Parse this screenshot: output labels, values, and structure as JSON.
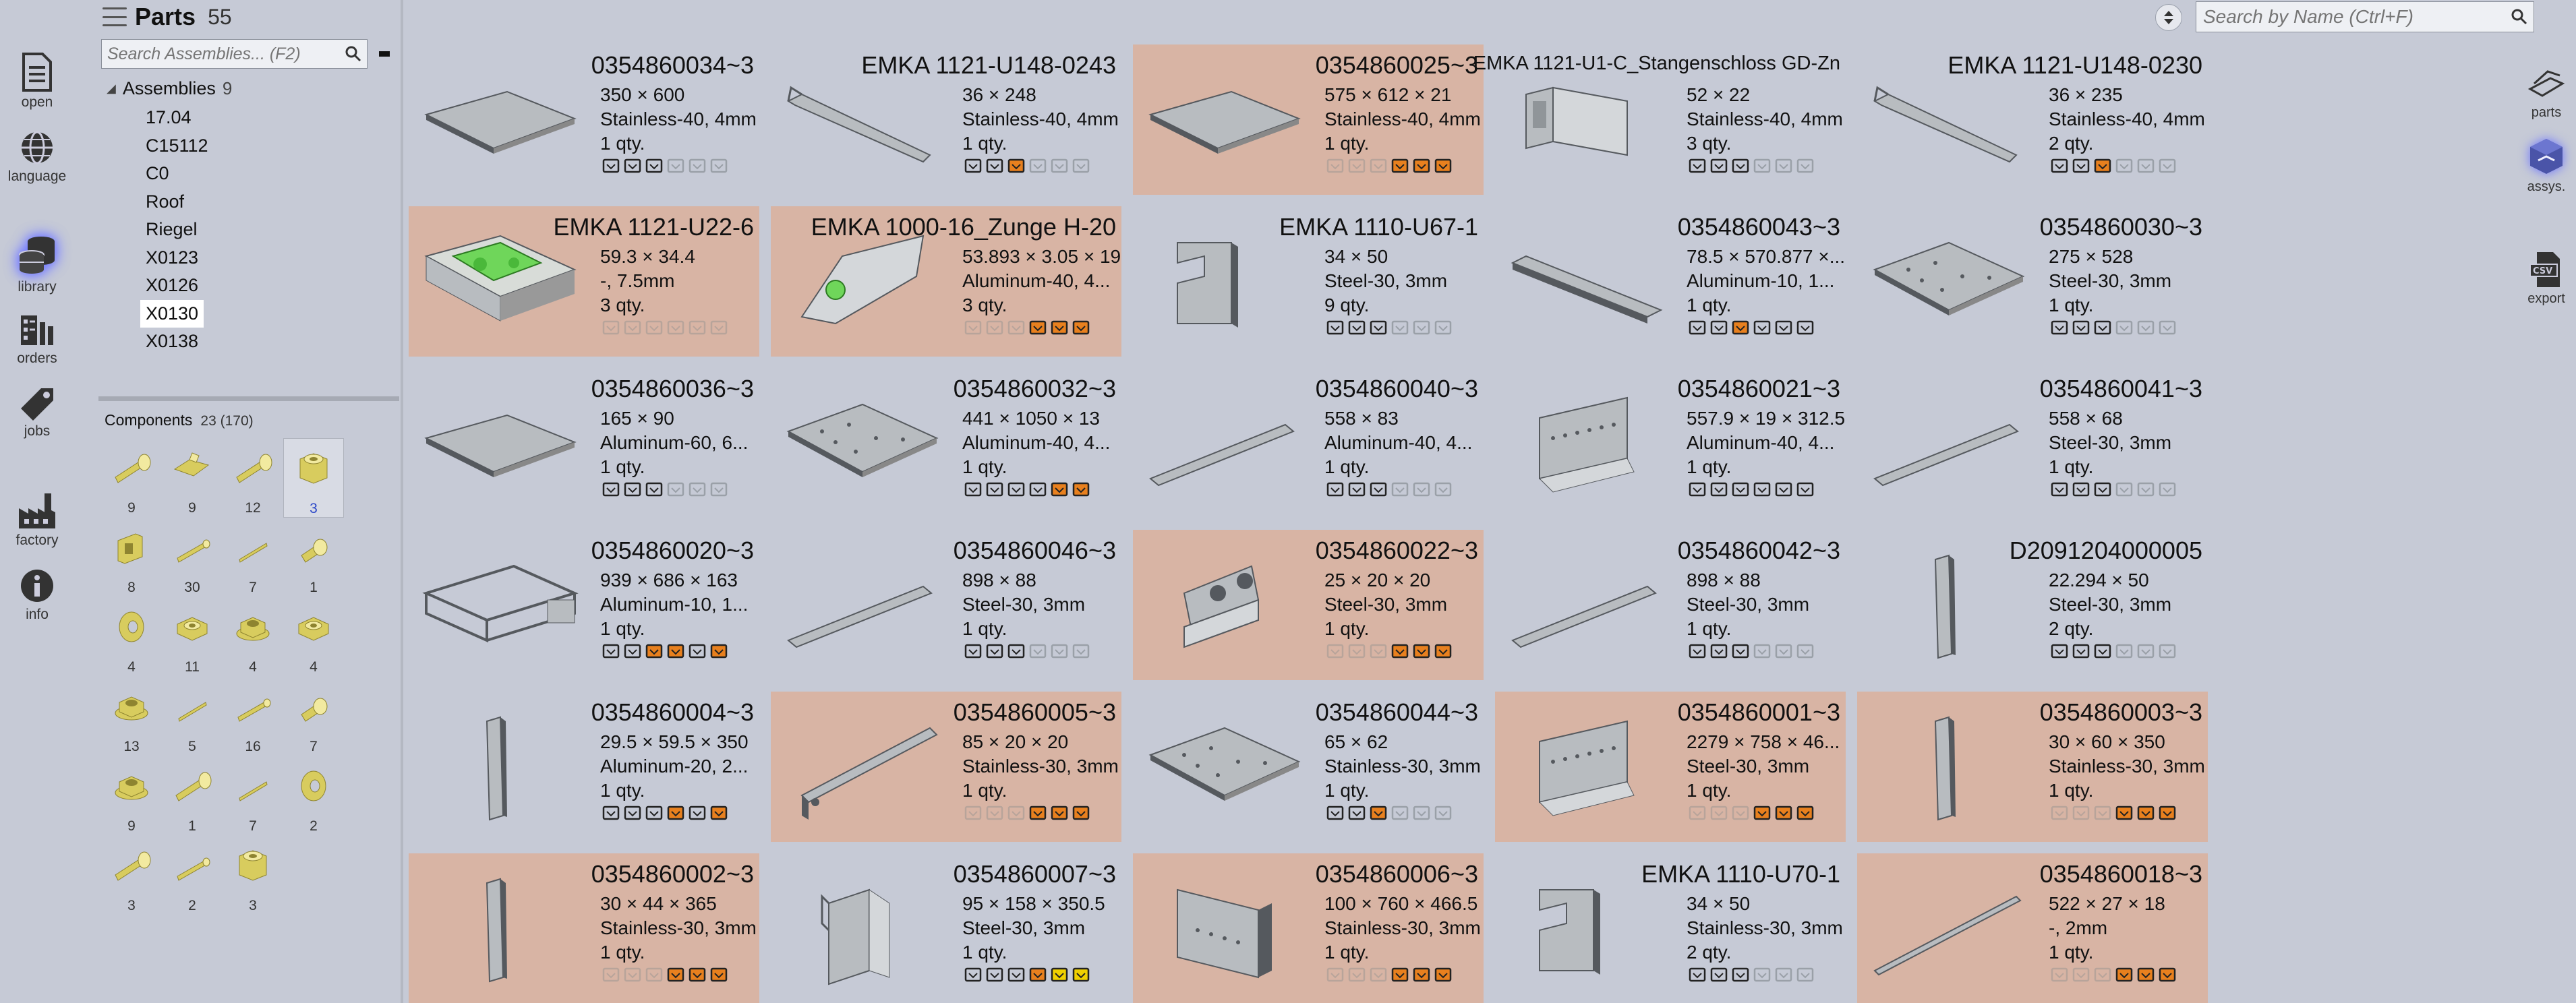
{
  "header": {
    "menu_icon": "hamburger-icon",
    "title": "Parts",
    "count": "55"
  },
  "nav": {
    "items": [
      {
        "label": "open",
        "icon": "document-icon"
      },
      {
        "label": "language",
        "icon": "globe-icon"
      },
      {
        "label": "library",
        "icon": "database-icon",
        "active": true
      },
      {
        "label": "orders",
        "icon": "orders-icon"
      },
      {
        "label": "jobs",
        "icon": "tag-icon"
      },
      {
        "label": "factory",
        "icon": "factory-icon"
      },
      {
        "label": "info",
        "icon": "info-icon"
      }
    ]
  },
  "assemblies": {
    "search_placeholder": "Search Assemblies... (F2)",
    "header": "Assemblies",
    "count": "9",
    "items": [
      "17.04",
      "C15112",
      "C0",
      "Roof",
      "Riegel",
      "X0123",
      "X0126",
      "X0130",
      "X0138"
    ],
    "selected": "X0130"
  },
  "components": {
    "header": "Components",
    "count": "23 (170)",
    "items": [
      {
        "count": "9",
        "shape": "bolt"
      },
      {
        "count": "9",
        "shape": "bracket"
      },
      {
        "count": "12",
        "shape": "bolt"
      },
      {
        "count": "3",
        "shape": "nut-tall",
        "selected": true
      },
      {
        "count": "8",
        "shape": "clip"
      },
      {
        "count": "30",
        "shape": "pin"
      },
      {
        "count": "7",
        "shape": "pin-thin"
      },
      {
        "count": "1",
        "shape": "bolt-short"
      },
      {
        "count": "4",
        "shape": "washer"
      },
      {
        "count": "11",
        "shape": "nut"
      },
      {
        "count": "4",
        "shape": "nut-flange"
      },
      {
        "count": "4",
        "shape": "nut"
      },
      {
        "count": "13",
        "shape": "nut-flange"
      },
      {
        "count": "5",
        "shape": "pin-thin"
      },
      {
        "count": "16",
        "shape": "pin"
      },
      {
        "count": "7",
        "shape": "bolt-short"
      },
      {
        "count": "9",
        "shape": "nut-flange"
      },
      {
        "count": "1",
        "shape": "bolt"
      },
      {
        "count": "7",
        "shape": "pin-thin"
      },
      {
        "count": "2",
        "shape": "washer"
      },
      {
        "count": "3",
        "shape": "bolt"
      },
      {
        "count": "2",
        "shape": "pin"
      },
      {
        "count": "3",
        "shape": "nut-tall"
      }
    ]
  },
  "search": {
    "placeholder_prefix": "Search by ",
    "placeholder_bold": "Name",
    "placeholder_suffix": " (Ctrl+F)"
  },
  "right_nav": [
    {
      "label": "parts",
      "icon": "parts-icon"
    },
    {
      "label": "assys.",
      "icon": "assembly-icon",
      "active": true
    },
    {
      "label": "export",
      "icon": "export-csv-icon"
    }
  ],
  "colors": {
    "background": "#c6cad6",
    "highlight": "#d8b4a4",
    "accent_orange": "#e8801e",
    "accent_yellow": "#f0d000"
  },
  "parts": [
    {
      "name": "0354860034~3",
      "dims": "350 × 600",
      "material": "Stainless-40, 4mm",
      "qty": "1 qty.",
      "hl": false,
      "shape": "plate",
      "status": [
        2,
        2,
        2,
        0,
        0,
        0
      ]
    },
    {
      "name": "EMKA 1121-U148-0243",
      "dims": "36 × 248",
      "material": "Stainless-40, 4mm",
      "qty": "1 qty.",
      "hl": false,
      "shape": "rod",
      "status": [
        2,
        2,
        3,
        0,
        0,
        0
      ]
    },
    {
      "name": "0354860025~3",
      "dims": "575 × 612 × 21",
      "material": "Stainless-40, 4mm",
      "qty": "1 qty.",
      "hl": true,
      "shape": "plate",
      "status": [
        1,
        1,
        1,
        3,
        3,
        3
      ]
    },
    {
      "name": "EMKA 1121-U1-C_Stangenschloss GD-Zn",
      "dims": "52 × 22",
      "material": "Stainless-40, 4mm",
      "qty": "3 qty.",
      "hl": false,
      "shape": "lock",
      "small": true,
      "status": [
        2,
        2,
        2,
        0,
        0,
        0
      ]
    },
    {
      "name": "EMKA 1121-U148-0230",
      "dims": "36 × 235",
      "material": "Stainless-40, 4mm",
      "qty": "2 qty.",
      "hl": false,
      "shape": "rod",
      "status": [
        2,
        2,
        3,
        0,
        0,
        0
      ]
    },
    {
      "name": "EMKA 1121-U22-6",
      "dims": "59.3 × 34.4",
      "material": "-, 7.5mm",
      "qty": "3 qty.",
      "hl": true,
      "shape": "green",
      "status": [
        1,
        1,
        1,
        1,
        1,
        1
      ]
    },
    {
      "name": "EMKA 1000-16_Zunge H-20",
      "dims": "53.893 × 3.05 × 19",
      "material": "Aluminum-40, 4...",
      "qty": "3 qty.",
      "hl": true,
      "shape": "tongue",
      "status": [
        1,
        1,
        1,
        3,
        3,
        3
      ]
    },
    {
      "name": "EMKA 1110-U67-1",
      "dims": "34 × 50",
      "material": "Steel-30, 3mm",
      "qty": "9 qty.",
      "hl": false,
      "shape": "notch",
      "status": [
        2,
        2,
        2,
        0,
        0,
        0
      ]
    },
    {
      "name": "0354860043~3",
      "dims": "78.5 × 570.877 ×...",
      "material": "Aluminum-10, 1...",
      "qty": "1 qty.",
      "hl": false,
      "shape": "channel",
      "status": [
        2,
        2,
        3,
        2,
        2,
        2
      ]
    },
    {
      "name": "0354860030~3",
      "dims": "275 × 528",
      "material": "Steel-30, 3mm",
      "qty": "1 qty.",
      "hl": false,
      "shape": "plate-holes",
      "status": [
        2,
        2,
        2,
        0,
        0,
        0
      ]
    },
    {
      "name": "0354860036~3",
      "dims": "165 × 90",
      "material": "Aluminum-60, 6...",
      "qty": "1 qty.",
      "hl": false,
      "shape": "plate",
      "status": [
        2,
        2,
        2,
        0,
        0,
        0
      ]
    },
    {
      "name": "0354860032~3",
      "dims": "441 × 1050 × 13",
      "material": "Aluminum-40, 4...",
      "qty": "1 qty.",
      "hl": false,
      "shape": "plate-holes",
      "status": [
        2,
        2,
        2,
        2,
        3,
        3
      ]
    },
    {
      "name": "0354860040~3",
      "dims": "558 × 83",
      "material": "Aluminum-40, 4...",
      "qty": "1 qty.",
      "hl": false,
      "shape": "strip",
      "status": [
        2,
        2,
        2,
        0,
        0,
        0
      ]
    },
    {
      "name": "0354860021~3",
      "dims": "557.9 × 19 × 312.5",
      "material": "Aluminum-40, 4...",
      "qty": "1 qty.",
      "hl": false,
      "shape": "bracket",
      "status": [
        2,
        2,
        2,
        2,
        2,
        2
      ]
    },
    {
      "name": "0354860041~3",
      "dims": "558 × 68",
      "material": "Steel-30, 3mm",
      "qty": "1 qty.",
      "hl": false,
      "shape": "strip",
      "status": [
        2,
        2,
        2,
        0,
        0,
        0
      ]
    },
    {
      "name": "0354860020~3",
      "dims": "939 × 686 × 163",
      "material": "Aluminum-10, 1...",
      "qty": "1 qty.",
      "hl": false,
      "shape": "frame",
      "status": [
        2,
        2,
        3,
        3,
        2,
        3
      ]
    },
    {
      "name": "0354860046~3",
      "dims": "898 × 88",
      "material": "Steel-30, 3mm",
      "qty": "1 qty.",
      "hl": false,
      "shape": "strip",
      "status": [
        2,
        2,
        2,
        0,
        0,
        0
      ]
    },
    {
      "name": "0354860022~3",
      "dims": "25 × 20 × 20",
      "material": "Steel-30, 3mm",
      "qty": "1 qty.",
      "hl": true,
      "shape": "angle",
      "status": [
        1,
        1,
        1,
        3,
        3,
        3
      ]
    },
    {
      "name": "0354860042~3",
      "dims": "898 × 88",
      "material": "Steel-30, 3mm",
      "qty": "1 qty.",
      "hl": false,
      "shape": "strip",
      "status": [
        2,
        2,
        2,
        0,
        0,
        0
      ]
    },
    {
      "name": "D2091204000005",
      "dims": "22.294 × 50",
      "material": "Steel-30, 3mm",
      "qty": "2 qty.",
      "hl": false,
      "shape": "bar-v",
      "status": [
        2,
        2,
        2,
        0,
        0,
        0
      ]
    },
    {
      "name": "0354860004~3",
      "dims": "29.5 × 59.5 × 350",
      "material": "Aluminum-20, 2...",
      "qty": "1 qty.",
      "hl": false,
      "shape": "bar-v",
      "status": [
        2,
        2,
        2,
        3,
        2,
        3
      ]
    },
    {
      "name": "0354860005~3",
      "dims": "85 × 20 × 20",
      "material": "Stainless-30, 3mm",
      "qty": "1 qty.",
      "hl": true,
      "shape": "lbar",
      "status": [
        1,
        1,
        1,
        3,
        3,
        3
      ]
    },
    {
      "name": "0354860044~3",
      "dims": "65 × 62",
      "material": "Stainless-30, 3mm",
      "qty": "1 qty.",
      "hl": false,
      "shape": "plate-holes",
      "status": [
        2,
        2,
        3,
        0,
        0,
        0
      ]
    },
    {
      "name": "0354860001~3",
      "dims": "2279 × 758 × 46...",
      "material": "Steel-30, 3mm",
      "qty": "1 qty.",
      "hl": true,
      "shape": "bracket",
      "status": [
        1,
        1,
        1,
        3,
        3,
        3
      ]
    },
    {
      "name": "0354860003~3",
      "dims": "30 × 60 × 350",
      "material": "Stainless-30, 3mm",
      "qty": "1 qty.",
      "hl": true,
      "shape": "bar-v",
      "status": [
        1,
        1,
        1,
        3,
        3,
        3
      ]
    },
    {
      "name": "0354860002~3",
      "dims": "30 × 44 × 365",
      "material": "Stainless-30, 3mm",
      "qty": "1 qty.",
      "hl": true,
      "shape": "bar-v",
      "status": [
        1,
        1,
        1,
        3,
        3,
        3
      ]
    },
    {
      "name": "0354860007~3",
      "dims": "95 × 158 × 350.5",
      "material": "Steel-30, 3mm",
      "qty": "1 qty.",
      "hl": false,
      "shape": "clip-part",
      "status": [
        2,
        2,
        2,
        3,
        4,
        4
      ]
    },
    {
      "name": "0354860006~3",
      "dims": "100 × 760 × 466.5",
      "material": "Stainless-30, 3mm",
      "qty": "1 qty.",
      "hl": true,
      "shape": "box",
      "status": [
        1,
        1,
        1,
        3,
        3,
        3
      ]
    },
    {
      "name": "EMKA 1110-U70-1",
      "dims": "34 × 50",
      "material": "Stainless-30, 3mm",
      "qty": "2 qty.",
      "hl": false,
      "shape": "notch",
      "status": [
        2,
        2,
        2,
        0,
        0,
        0
      ]
    },
    {
      "name": "0354860018~3",
      "dims": "522 × 27 × 18",
      "material": "-, 2mm",
      "qty": "1 qty.",
      "hl": true,
      "shape": "long-rod",
      "status": [
        1,
        1,
        1,
        3,
        3,
        3
      ]
    }
  ]
}
